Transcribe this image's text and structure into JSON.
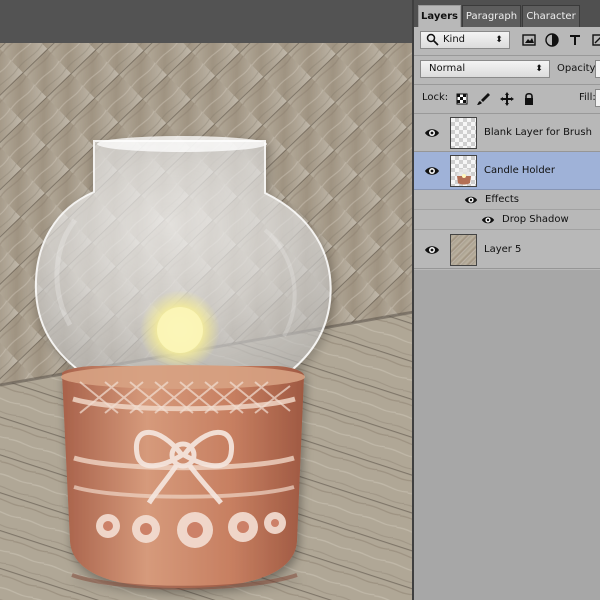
{
  "tabs": {
    "layers": "Layers",
    "paragraph": "Paragraph",
    "character": "Character"
  },
  "filter": {
    "kind": "Kind",
    "icons": [
      "search-icon",
      "image-filter-icon",
      "adjustment-filter-icon",
      "type-filter-icon",
      "shape-filter-icon"
    ]
  },
  "blend": {
    "mode": "Normal",
    "opacity_label": "Opacity:"
  },
  "lock": {
    "label": "Lock:",
    "fill_label": "Fill:",
    "icons": [
      "lock-transparent-icon",
      "lock-brush-icon",
      "lock-move-icon",
      "lock-all-icon"
    ]
  },
  "layers": [
    {
      "name": "Blank Layer for Brush",
      "visible": true,
      "selected": false,
      "thumbnail": "transparent-thumbnail"
    },
    {
      "name": "Candle Holder",
      "visible": true,
      "selected": true,
      "thumbnail": "candle-holder-thumbnail"
    },
    {
      "name": "Layer 5",
      "visible": true,
      "selected": false,
      "thumbnail": "wood-thumbnail"
    }
  ],
  "effects": {
    "label": "Effects",
    "drop_shadow": "Drop Shadow"
  },
  "colors": {
    "selected_layer": "#9fb2d8",
    "panel_background": "#b8b8b8",
    "canvas_background": "#535353",
    "candle_holder": "#c98563",
    "glow": "#f7f0a5"
  }
}
